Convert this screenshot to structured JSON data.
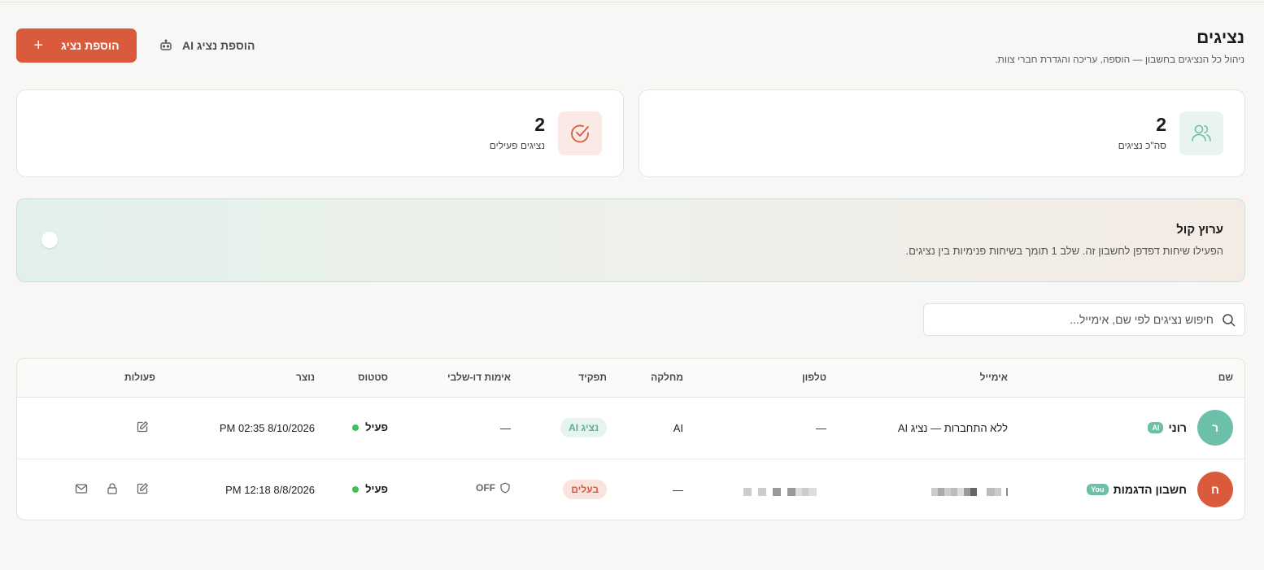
{
  "header": {
    "title": "נציגים",
    "subtitle": "ניהול כל הנציגים בחשבון — הוספה, עריכה והגדרת חברי צוות.",
    "add_agent_label": "הוספת נציג",
    "add_ai_agent_label": "הוספת נציג AI"
  },
  "stats": {
    "total": {
      "value": "2",
      "label": "סה\"כ נציגים",
      "icon": "users-icon"
    },
    "active": {
      "value": "2",
      "label": "נציגים פעילים",
      "icon": "check-circle-icon"
    }
  },
  "voice_channel": {
    "title": "ערוץ קול",
    "description": "הפעילו שיחות דפדפן לחשבון זה. שלב 1 תומך בשיחות פנימיות בין נציגים.",
    "enabled": false
  },
  "search": {
    "placeholder": "חיפוש נציגים לפי שם, אימייל..."
  },
  "table": {
    "columns": {
      "name": "שם",
      "email": "אימייל",
      "phone": "טלפון",
      "department": "מחלקה",
      "role": "תפקיד",
      "twofa": "אימות דו-שלבי",
      "status": "סטטוס",
      "created": "נוצר",
      "actions": "פעולות"
    },
    "rows": [
      {
        "avatar_letter": "ר",
        "avatar_color": "#6cbfa9",
        "name": "רוני",
        "tag": "AI",
        "email": "ללא התחברות — נציג AI",
        "phone": "—",
        "department": "AI",
        "role": "נציג AI",
        "twofa": "—",
        "status": "פעיל",
        "created": "8/10/2026 02:35 PM"
      },
      {
        "avatar_letter": "ח",
        "avatar_color": "#d95b3c",
        "name": "חשבון הדגמות",
        "tag": "You",
        "email": "",
        "phone": "",
        "department": "—",
        "role": "בעלים",
        "twofa": "OFF",
        "status": "פעיל",
        "created": "8/8/2026 12:18 PM"
      }
    ]
  },
  "colors": {
    "accent": "#d95b3c",
    "teal": "#6cbfa9",
    "status_active": "#3cc45a"
  }
}
